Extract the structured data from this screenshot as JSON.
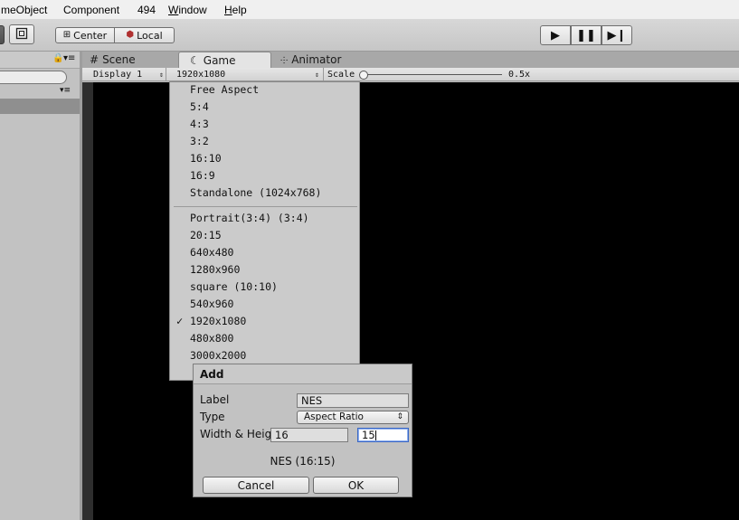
{
  "menubar": {
    "items": [
      "meObject",
      "Component",
      "494",
      "Window",
      "Help"
    ]
  },
  "toolbar": {
    "pivot_label": "Center",
    "space_label": "Local",
    "play_icon": "play-icon",
    "pause_icon": "pause-icon",
    "step_icon": "step-icon"
  },
  "tabs": {
    "scene": "Scene",
    "game": "Game",
    "animator": "Animator"
  },
  "gamebar": {
    "display": "Display 1",
    "resolution": "1920x1080",
    "scale_label": "Scale",
    "scale_value": "0.5x",
    "scale_level": 0.0
  },
  "dropdown": {
    "group1": [
      "Free Aspect",
      "5:4",
      "4:3",
      "3:2",
      "16:10",
      "16:9",
      "Standalone (1024x768)"
    ],
    "group2": [
      "Portrait(3:4) (3:4)",
      "20:15",
      "640x480",
      "1280x960",
      "square (10:10)",
      "540x960",
      "1920x1080",
      "480x800",
      "3000x2000"
    ],
    "checked": "1920x1080"
  },
  "dialog": {
    "title": "Add",
    "label_label": "Label",
    "label_value": "NES",
    "type_label": "Type",
    "type_value": "Aspect Ratio",
    "wh_label": "Width & Height",
    "width_value": "16",
    "height_value": "15",
    "preview": "NES (16:15)",
    "cancel": "Cancel",
    "ok": "OK"
  }
}
